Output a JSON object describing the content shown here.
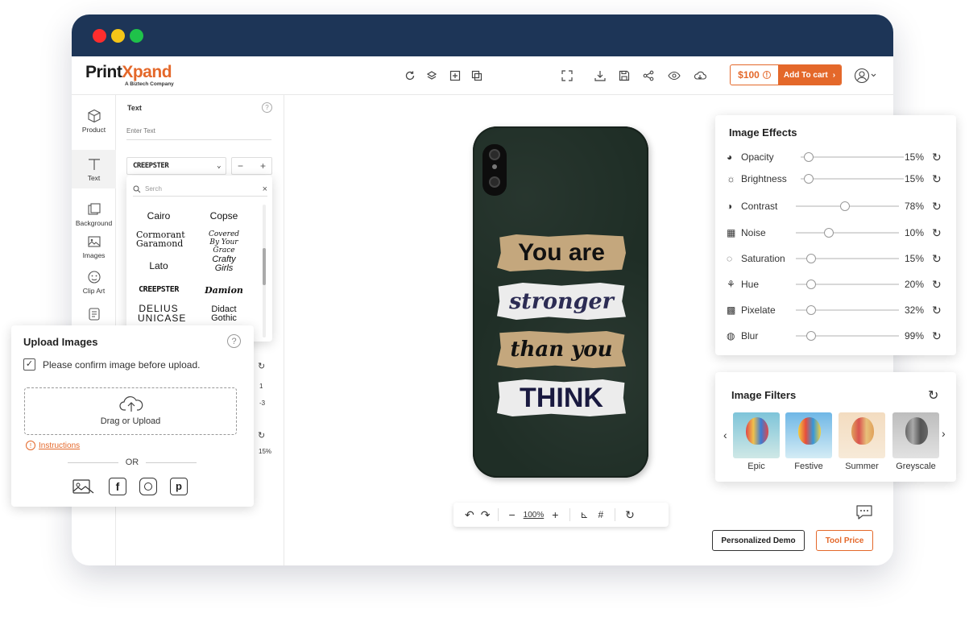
{
  "brand": {
    "logo_main": "Print",
    "logo_x": "X",
    "logo_rest": "pand",
    "tagline": "A Biztech Company"
  },
  "toolbar": {
    "left_icons": [
      "refresh-icon",
      "layers-icon",
      "add-layer-icon",
      "duplicate-icon"
    ],
    "right_icons": [
      "fullscreen-icon",
      "download-icon",
      "save-icon",
      "share-icon",
      "preview-icon",
      "cloud-icon"
    ],
    "price": "$100",
    "add_to_cart": "Add To cart"
  },
  "sidebar": {
    "items": [
      {
        "label": "Product",
        "icon": "box-icon"
      },
      {
        "label": "Text",
        "icon": "text-icon"
      },
      {
        "label": "Background",
        "icon": "background-icon"
      },
      {
        "label": "Images",
        "icon": "image-icon"
      },
      {
        "label": "Clip Art",
        "icon": "clipart-icon"
      },
      {
        "label": "Templates",
        "icon": "templates-icon"
      }
    ]
  },
  "text_panel": {
    "title": "Text",
    "placeholder": "Enter Text",
    "font_selected": "CREEPSTER",
    "search_placeholder": "Serch",
    "fonts": [
      [
        "Cairo",
        "Copse"
      ],
      [
        "Cormorant Garamond",
        "Covered By Your Grace"
      ],
      [
        "Lato",
        "Crafty Girls"
      ],
      [
        "CREEPSTER",
        "Damion"
      ],
      [
        "DELIUS UNICASE",
        "Didact Gothic"
      ]
    ],
    "hidden_values": [
      "1",
      "-3",
      "15%"
    ]
  },
  "upload": {
    "title": "Upload Images",
    "confirm_label": "Please confirm image before upload.",
    "drag_label": "Drag or Upload",
    "instructions": "Instructions",
    "or": "OR",
    "sources": [
      "gallery-icon",
      "facebook-icon",
      "instagram-icon",
      "pinterest-icon"
    ]
  },
  "phone_design": {
    "line1": "You are",
    "line2": "stronger",
    "line3": "than you",
    "line4": "THINK"
  },
  "zoom": {
    "level": "100%"
  },
  "effects": {
    "title": "Image Effects",
    "items": [
      {
        "label": "Opacity",
        "value": "15%",
        "level": 0.03
      },
      {
        "label": "Brightness",
        "value": "15%",
        "level": 0.03
      },
      {
        "label": "Contrast",
        "value": "78%",
        "level": 0.43
      },
      {
        "label": "Noise",
        "value": "10%",
        "level": 0.27
      },
      {
        "label": "Saturation",
        "value": "15%",
        "level": 0.1
      },
      {
        "label": "Hue",
        "value": "20%",
        "level": 0.1
      },
      {
        "label": "Pixelate",
        "value": "32%",
        "level": 0.1
      },
      {
        "label": "Blur",
        "value": "99%",
        "level": 0.1
      }
    ]
  },
  "filters": {
    "title": "Image Filters",
    "items": [
      "Epic",
      "Festive",
      "Summer",
      "Greyscale"
    ]
  },
  "footer": {
    "demo": "Personalized Demo",
    "tool_price": "Tool Price"
  },
  "colors": {
    "navy": "#1d3557",
    "accent": "#e4682a",
    "phone": "#1f2e26",
    "tan": "#c4a77d"
  }
}
